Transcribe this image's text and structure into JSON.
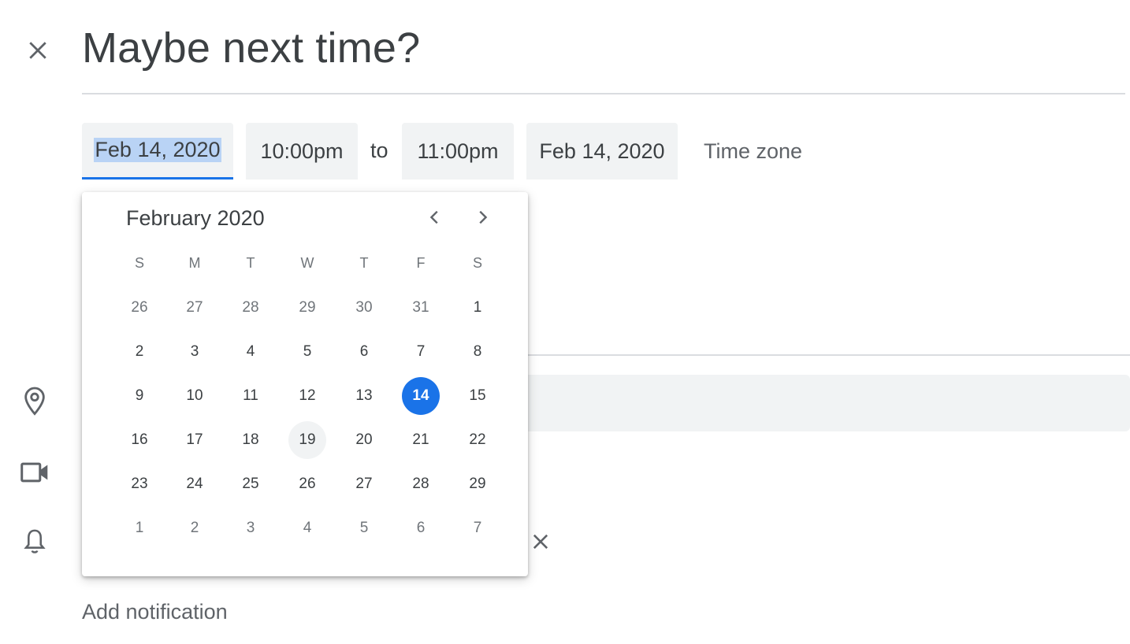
{
  "header": {
    "close_icon": "close-icon",
    "title": "Maybe next time?"
  },
  "datetime": {
    "start_date": "Feb 14, 2020",
    "start_time": "10:00pm",
    "to_label": "to",
    "end_time": "11:00pm",
    "end_date": "Feb 14, 2020",
    "timezone_label": "Time zone"
  },
  "calendar": {
    "month_label": "February 2020",
    "prev_icon": "chevron-left-icon",
    "next_icon": "chevron-right-icon",
    "weekdays": [
      "S",
      "M",
      "T",
      "W",
      "T",
      "F",
      "S"
    ],
    "weeks": [
      [
        {
          "d": "26",
          "muted": true
        },
        {
          "d": "27",
          "muted": true
        },
        {
          "d": "28",
          "muted": true
        },
        {
          "d": "29",
          "muted": true
        },
        {
          "d": "30",
          "muted": true
        },
        {
          "d": "31",
          "muted": true
        },
        {
          "d": "1"
        }
      ],
      [
        {
          "d": "2"
        },
        {
          "d": "3"
        },
        {
          "d": "4"
        },
        {
          "d": "5"
        },
        {
          "d": "6"
        },
        {
          "d": "7"
        },
        {
          "d": "8"
        }
      ],
      [
        {
          "d": "9"
        },
        {
          "d": "10"
        },
        {
          "d": "11"
        },
        {
          "d": "12"
        },
        {
          "d": "13"
        },
        {
          "d": "14",
          "selected": true
        },
        {
          "d": "15"
        }
      ],
      [
        {
          "d": "16"
        },
        {
          "d": "17"
        },
        {
          "d": "18"
        },
        {
          "d": "19",
          "today": true
        },
        {
          "d": "20"
        },
        {
          "d": "21"
        },
        {
          "d": "22"
        }
      ],
      [
        {
          "d": "23"
        },
        {
          "d": "24"
        },
        {
          "d": "25"
        },
        {
          "d": "26"
        },
        {
          "d": "27"
        },
        {
          "d": "28"
        },
        {
          "d": "29"
        }
      ],
      [
        {
          "d": "1",
          "muted": true
        },
        {
          "d": "2",
          "muted": true
        },
        {
          "d": "3",
          "muted": true
        },
        {
          "d": "4",
          "muted": true
        },
        {
          "d": "5",
          "muted": true
        },
        {
          "d": "6",
          "muted": true
        },
        {
          "d": "7",
          "muted": true
        }
      ]
    ],
    "accent_color": "#1a73e8",
    "today_highlight_color": "#f1f3f4"
  },
  "sidebar_icons": [
    "location-pin-icon",
    "video-camera-icon",
    "bell-icon"
  ],
  "notification": {
    "remove_icon": "close-icon",
    "add_label": "Add notification"
  }
}
